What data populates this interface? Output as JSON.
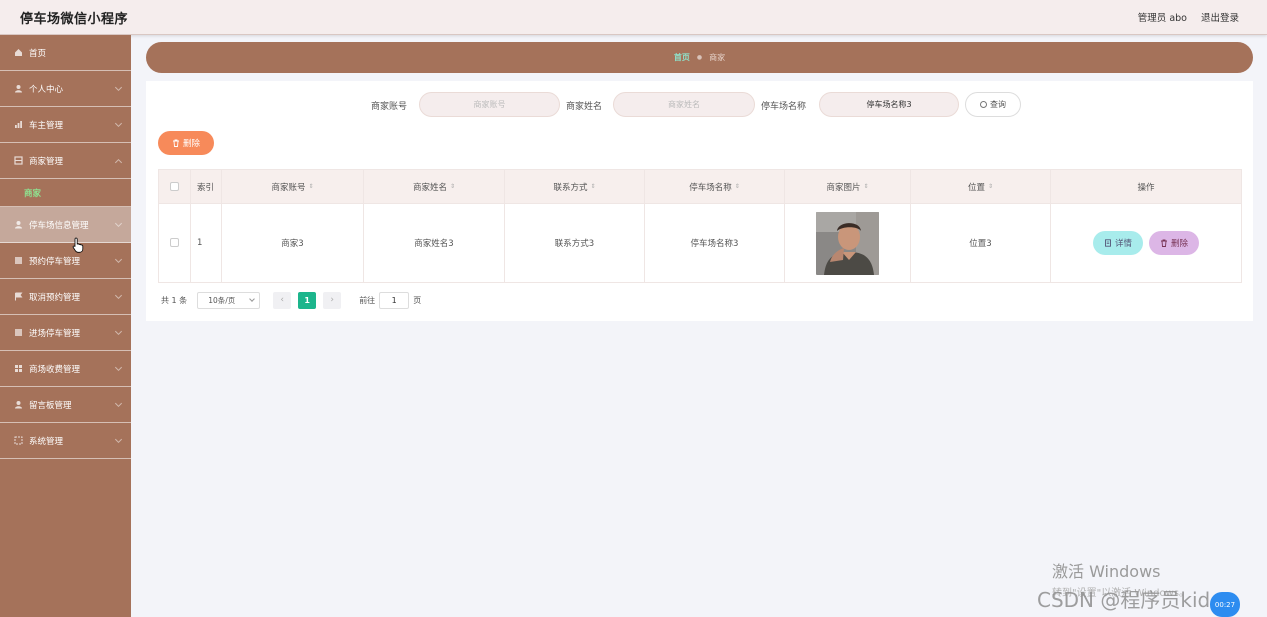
{
  "app": {
    "title": "停车场微信小程序"
  },
  "header": {
    "user": "管理员 abo",
    "logout": "退出登录"
  },
  "sidebar": {
    "items": [
      {
        "label": "首页",
        "icon": "home-icon"
      },
      {
        "label": "个人中心",
        "icon": "user-icon"
      },
      {
        "label": "车主管理",
        "icon": "chart-icon"
      },
      {
        "label": "商家管理",
        "icon": "grid-icon"
      },
      {
        "label": "商家",
        "icon": ""
      },
      {
        "label": "停车场信息管理",
        "icon": "user-icon"
      },
      {
        "label": "预约停车管理",
        "icon": "grid-icon"
      },
      {
        "label": "取消预约管理",
        "icon": "flag-icon"
      },
      {
        "label": "进场停车管理",
        "icon": "grid-icon"
      },
      {
        "label": "商场收费管理",
        "icon": "apps-icon"
      },
      {
        "label": "留言板管理",
        "icon": "user-icon"
      },
      {
        "label": "系统管理",
        "icon": "frame-icon"
      }
    ]
  },
  "breadcrumb": {
    "home": "首页",
    "current": "商家"
  },
  "search": {
    "account_label": "商家账号",
    "account_placeholder": "商家账号",
    "name_label": "商家姓名",
    "name_placeholder": "商家姓名",
    "parking_label": "停车场名称",
    "parking_value": "停车场名称3",
    "button": "查询"
  },
  "toolbar": {
    "delete": "删除"
  },
  "table": {
    "headers": [
      "索引",
      "商家账号",
      "商家姓名",
      "联系方式",
      "停车场名称",
      "商家图片",
      "位置",
      "操作"
    ],
    "rows": [
      {
        "index": "1",
        "account": "商家3",
        "name": "商家姓名3",
        "contact": "联系方式3",
        "parking": "停车场名称3",
        "location": "位置3",
        "detail": "详情",
        "delete": "删除"
      }
    ]
  },
  "pagination": {
    "total": "共 1 条",
    "page_size": "10条/页",
    "current_page": "1",
    "goto_label": "前往",
    "goto_value": "1",
    "goto_suffix": "页"
  },
  "watermark": {
    "windows_line1": "激活 Windows",
    "windows_line2": "转到\"设置\"以激活 Windows。",
    "csdn": "CSDN @程序员kido",
    "badge": "00:27"
  },
  "colors": {
    "sidebar": "#a5725a",
    "active_item": "#c5a89b",
    "delete_button": "#f78a5a",
    "page_active": "#1cb58c",
    "detail_button": "#a8ecec",
    "row_delete_button": "#dcb6e6"
  }
}
